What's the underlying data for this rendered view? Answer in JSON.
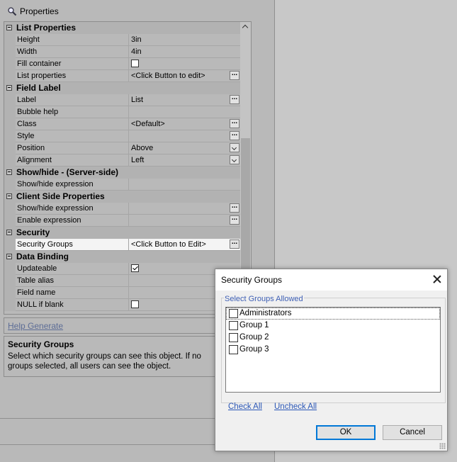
{
  "panel": {
    "title": "Properties",
    "categories": [
      {
        "label": "List Properties",
        "rows": [
          {
            "name": "Height",
            "value": "3in",
            "widget": "none"
          },
          {
            "name": "Width",
            "value": "4in",
            "widget": "none"
          },
          {
            "name": "Fill container",
            "value": "",
            "widget": "checkbox",
            "checked": false
          },
          {
            "name": "List properties",
            "value": "<Click Button to edit>",
            "widget": "ellipsis"
          }
        ]
      },
      {
        "label": "Field Label",
        "rows": [
          {
            "name": "Label",
            "value": "List",
            "widget": "ellipsis"
          },
          {
            "name": "Bubble help",
            "value": "",
            "widget": "none"
          },
          {
            "name": "Class",
            "value": "<Default>",
            "widget": "ellipsis"
          },
          {
            "name": "Style",
            "value": "",
            "widget": "ellipsis"
          },
          {
            "name": "Position",
            "value": "Above",
            "widget": "dropdown"
          },
          {
            "name": "Alignment",
            "value": "Left",
            "widget": "dropdown"
          }
        ]
      },
      {
        "label": "Show/hide - (Server-side)",
        "rows": [
          {
            "name": "Show/hide expression",
            "value": "",
            "widget": "none"
          }
        ]
      },
      {
        "label": "Client Side Properties",
        "rows": [
          {
            "name": "Show/hide expression",
            "value": "",
            "widget": "ellipsis"
          },
          {
            "name": "Enable expression",
            "value": "",
            "widget": "ellipsis"
          }
        ]
      },
      {
        "label": "Security",
        "rows": [
          {
            "name": "Security Groups",
            "value": "<Click Button to Edit>",
            "widget": "ellipsis",
            "selected": true
          }
        ]
      },
      {
        "label": "Data Binding",
        "rows": [
          {
            "name": "Updateable",
            "value": "",
            "widget": "checkbox",
            "checked": true
          },
          {
            "name": "Table alias",
            "value": "",
            "widget": "none"
          },
          {
            "name": "Field name",
            "value": "",
            "widget": "none"
          },
          {
            "name": "NULL if blank",
            "value": "",
            "widget": "checkbox",
            "checked": false
          }
        ]
      }
    ],
    "help_generate": "Help Generate",
    "description": {
      "title": "Security Groups",
      "text": "Select which security groups can see this object. If no groups selected, all users can see the object."
    }
  },
  "dialog": {
    "title": "Security Groups",
    "group_label": "Select Groups Allowed",
    "groups": [
      {
        "label": "Administrators",
        "checked": false
      },
      {
        "label": "Group 1",
        "checked": false
      },
      {
        "label": "Group 2",
        "checked": false
      },
      {
        "label": "Group 3",
        "checked": false
      }
    ],
    "check_all": "Check All",
    "uncheck_all": "Uncheck All",
    "ok": "OK",
    "cancel": "Cancel"
  },
  "colors": {
    "panel_bg": "#b9b9b9",
    "link": "#2b57b6",
    "group_label": "#3e5fb4",
    "ok_border": "#0078d7"
  }
}
